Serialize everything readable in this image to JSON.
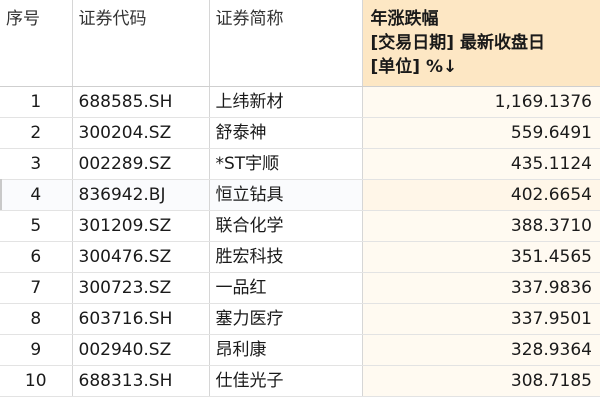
{
  "table": {
    "headers": {
      "index": "序号",
      "code": "证券代码",
      "name": "证券简称",
      "value_line1": "年涨跌幅",
      "value_line2": "[交易日期] 最新收盘日",
      "value_line3": "[单位] %↓"
    },
    "rows": [
      {
        "index": "1",
        "code": "688585.SH",
        "name": "上纬新材",
        "value": "1,169.1376"
      },
      {
        "index": "2",
        "code": "300204.SZ",
        "name": "舒泰神",
        "value": "559.6491"
      },
      {
        "index": "3",
        "code": "002289.SZ",
        "name": "*ST宇顺",
        "value": "435.1124"
      },
      {
        "index": "4",
        "code": "836942.BJ",
        "name": "恒立钻具",
        "value": "402.6654"
      },
      {
        "index": "5",
        "code": "301209.SZ",
        "name": "联合化学",
        "value": "388.3710"
      },
      {
        "index": "6",
        "code": "300476.SZ",
        "name": "胜宏科技",
        "value": "351.4565"
      },
      {
        "index": "7",
        "code": "300723.SZ",
        "name": "一品红",
        "value": "337.9836"
      },
      {
        "index": "8",
        "code": "603716.SH",
        "name": "塞力医疗",
        "value": "337.9501"
      },
      {
        "index": "9",
        "code": "002940.SZ",
        "name": "昂利康",
        "value": "328.9364"
      },
      {
        "index": "10",
        "code": "688313.SH",
        "name": "仕佳光子",
        "value": "308.7185"
      }
    ]
  }
}
